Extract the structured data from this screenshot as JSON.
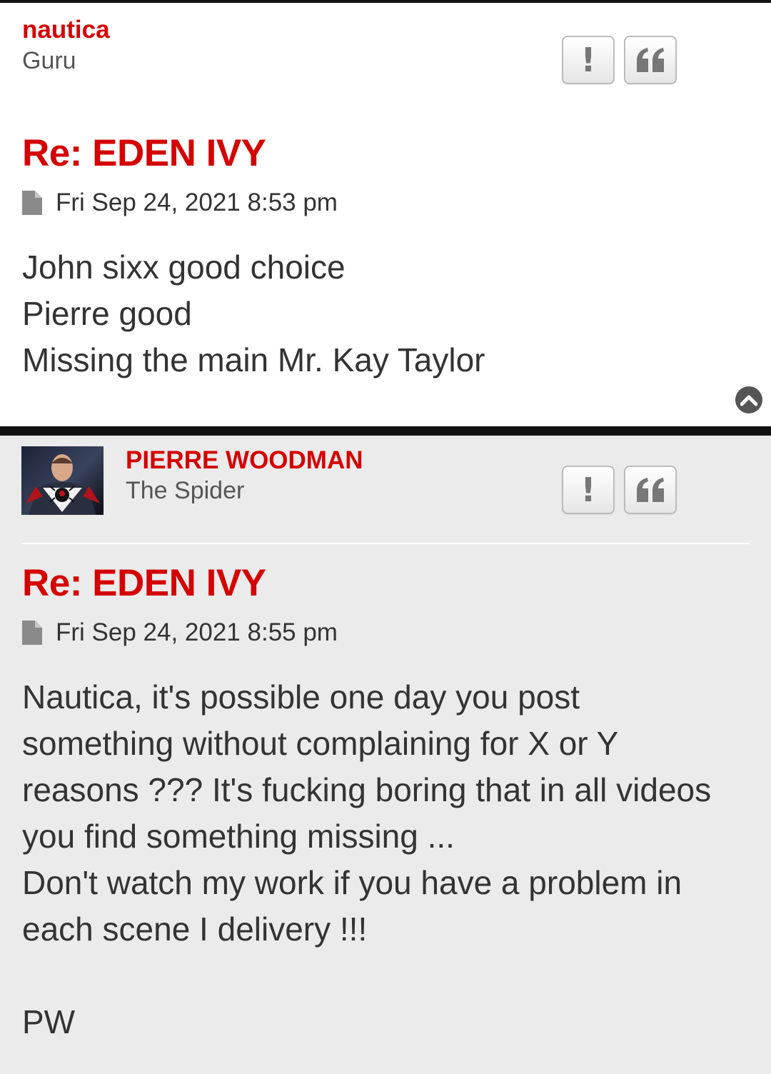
{
  "posts": [
    {
      "username": "nautica",
      "rank": "Guru",
      "report_label": "!",
      "title": "Re: EDEN IVY",
      "date": "Fri Sep 24, 2021 8:53 pm",
      "content": [
        "John sixx good choice",
        "Pierre good",
        "Missing the main Mr. Kay Taylor"
      ]
    },
    {
      "username": "PIERRE WOODMAN",
      "rank": "The Spider",
      "report_label": "!",
      "title": "Re: EDEN IVY",
      "date": "Fri Sep 24, 2021 8:55 pm",
      "content": [
        "Nautica, it's possible one day you post something without complaining for X or Y reasons ??? It's fucking boring that in all videos you find something missing ...",
        "Don't watch my work if you have a problem in each scene I delivery !!!",
        "",
        "PW"
      ]
    }
  ],
  "icons": {
    "report": "exclamation-icon",
    "quote": "quote-icon",
    "post": "document-icon",
    "top": "chevron-up-circle-icon",
    "avatar": "spider-logo-avatar"
  },
  "colors": {
    "accent": "#d40000",
    "post_bg_alt": "#ebebeb",
    "text": "#333333"
  }
}
